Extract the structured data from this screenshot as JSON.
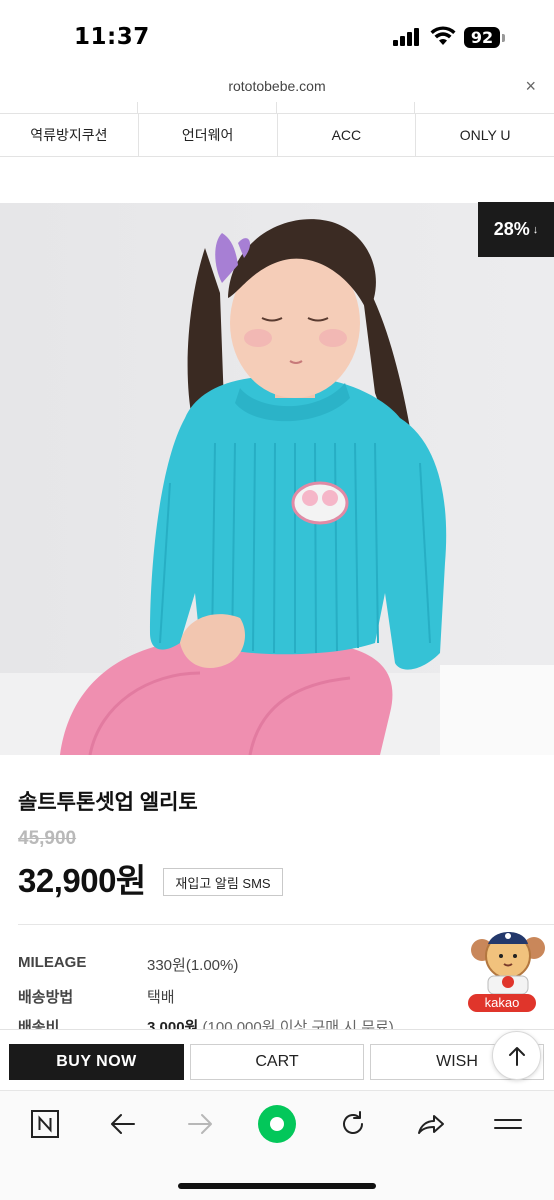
{
  "status_bar": {
    "time": "11:37",
    "battery": "92"
  },
  "browser": {
    "url": "rototobebe.com",
    "close_label": "×"
  },
  "categories": [
    "역류방지쿠션",
    "언더웨어",
    "ACC",
    "ONLY U"
  ],
  "hero": {
    "discount": "28%",
    "discount_arrow": "↓"
  },
  "product": {
    "name": "솔트투톤셋업 엘리토",
    "original_price": "45,900",
    "sale_price": "32,900원",
    "restock_label": "재입고 알림 SMS"
  },
  "info": {
    "mileage_label": "MILEAGE",
    "mileage_value": "330원(1.00%)",
    "shipping_method_label": "배송방법",
    "shipping_method_value": "택배",
    "shipping_fee_label": "배송비",
    "shipping_fee_value": "3,000원",
    "shipping_fee_note": "(100,000원 이상 구매 시 무료)"
  },
  "kakao": {
    "label": "kakao"
  },
  "actions": {
    "buy_now": "BUY NOW",
    "cart": "CART",
    "wish": "WISH"
  },
  "colors": {
    "accent_dark": "#1a1a1a",
    "kakao_red": "#e0352b",
    "naver_green": "#03c75a"
  }
}
